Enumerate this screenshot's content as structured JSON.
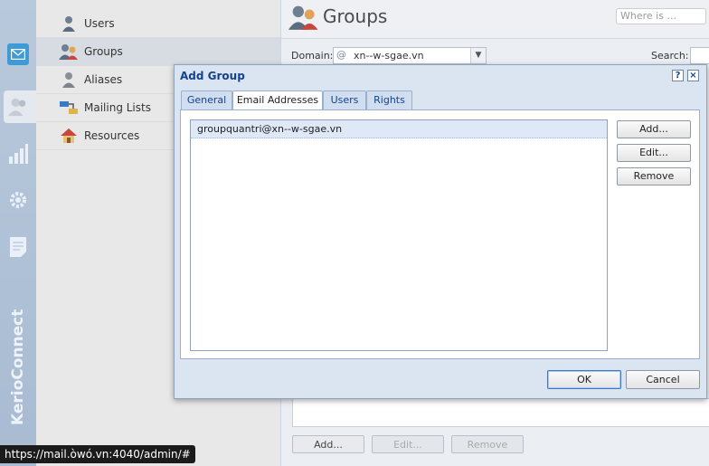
{
  "rail": {
    "brand": "KerioConnect",
    "icons": [
      "mail-icon",
      "users-icon",
      "chart-icon",
      "gear-icon",
      "log-icon"
    ]
  },
  "nav": {
    "items": [
      {
        "label": "Users",
        "icon": "user-icon"
      },
      {
        "label": "Groups",
        "icon": "group-icon"
      },
      {
        "label": "Aliases",
        "icon": "alias-icon"
      },
      {
        "label": "Mailing Lists",
        "icon": "mailing-list-icon"
      },
      {
        "label": "Resources",
        "icon": "house-icon"
      }
    ],
    "selected": "Groups"
  },
  "main": {
    "title": "Groups",
    "where_placeholder": "Where is ...",
    "domain_label": "Domain:",
    "domain_value": "xn--w-sgae.vn",
    "search_label": "Search:",
    "buttons": [
      "Add...",
      "Edit...",
      "Remove"
    ]
  },
  "dialog": {
    "title": "Add Group",
    "help": "?",
    "close": "×",
    "tabs": [
      "General",
      "Email Addresses",
      "Users",
      "Rights"
    ],
    "active_tab": "Email Addresses",
    "addresses": [
      "groupquantri@xn--w-sgae.vn"
    ],
    "side_buttons": [
      "Add...",
      "Edit...",
      "Remove"
    ],
    "ok": "OK",
    "cancel": "Cancel"
  },
  "status_bar": "https://mail.òwó.vn:4040/admin/#"
}
